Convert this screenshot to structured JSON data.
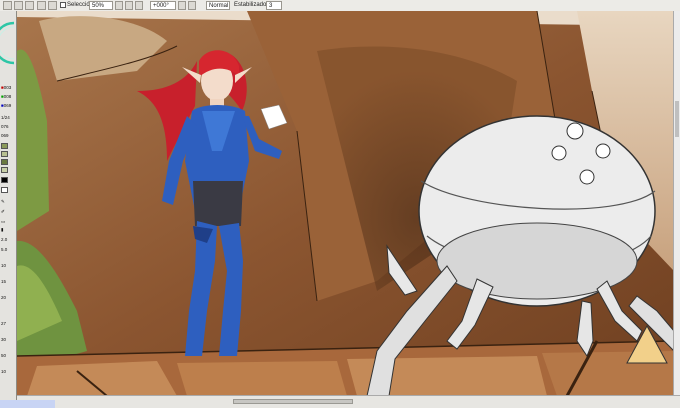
{
  "toolbar": {
    "selection_label": "Selección",
    "zoom_value": "50%",
    "angle_value": "+000°",
    "blend_mode": "Normal",
    "stabilizer_label": "Estabilizador",
    "stabilizer_value": "3"
  },
  "left_panel": {
    "color_values": [
      "003",
      "008",
      "069",
      "1/24",
      "076",
      "069"
    ],
    "color_swatches": [
      "#c8a0a0",
      "#a0c8a0",
      "#a0a0c8"
    ],
    "brush_sizes": [
      "2.0",
      "5.0",
      "10",
      "15",
      "20",
      "27",
      "30",
      "50",
      "10"
    ]
  },
  "colors": {
    "app_bg": "#d4d0c8",
    "canvas_bg": "#8b5a34"
  }
}
